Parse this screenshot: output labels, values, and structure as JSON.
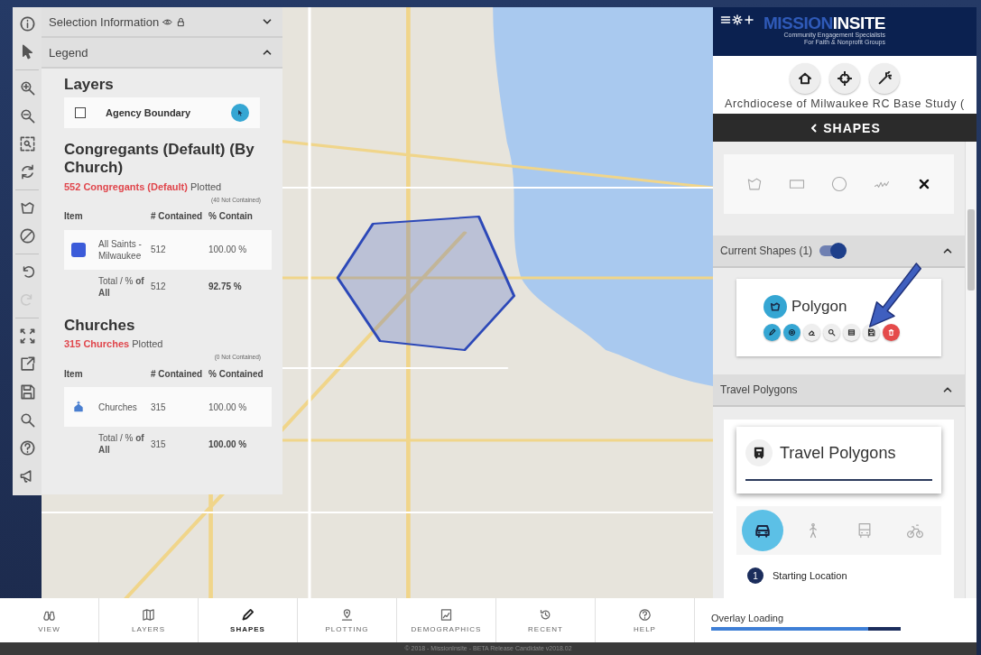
{
  "toolbar": [
    {
      "kind": "info",
      "disabled": false
    },
    {
      "kind": "pointer",
      "disabled": false
    },
    {
      "kind": "zoomin",
      "disabled": false
    },
    {
      "kind": "zoomout",
      "disabled": false
    },
    {
      "kind": "zoombox",
      "disabled": false
    },
    {
      "kind": "refresh",
      "disabled": false
    },
    {
      "kind": "polygon",
      "disabled": false
    },
    {
      "kind": "block",
      "disabled": false
    },
    {
      "kind": "undo",
      "disabled": false
    },
    {
      "kind": "redo",
      "disabled": true
    },
    {
      "kind": "expand",
      "disabled": false
    },
    {
      "kind": "export",
      "disabled": false
    },
    {
      "kind": "save",
      "disabled": false
    },
    {
      "kind": "search",
      "disabled": false
    },
    {
      "kind": "help",
      "disabled": false
    },
    {
      "kind": "megaphone",
      "disabled": false
    }
  ],
  "selection_panel": {
    "title": "Selection Information",
    "expanded": false
  },
  "legend": {
    "title": "Legend",
    "expanded": true,
    "layers": {
      "heading": "Layers",
      "items": [
        {
          "label": "Agency Boundary",
          "checked": false
        }
      ]
    },
    "sections": [
      {
        "heading": "Congregants (Default) (By Church)",
        "count": "552 Congregants (Default)",
        "plotted": "Plotted",
        "note": "(40 Not Contained)",
        "columns": [
          "Item",
          "# Contained",
          "% Contain"
        ],
        "rows": [
          {
            "kind": "swatch",
            "color": "#3b5bd9",
            "item": "All Saints - Milwaukee",
            "contained": "512",
            "percent": "100.00 %"
          }
        ],
        "total": {
          "label": "Total / % **of All**",
          "contained": "512",
          "percent": "92.75 %"
        }
      },
      {
        "heading": "Churches",
        "count": "315 Churches",
        "plotted": "Plotted",
        "note": "(0 Not Contained)",
        "columns": [
          "Item",
          "# Contained",
          "% Contained"
        ],
        "rows": [
          {
            "kind": "church",
            "color": "#4a7fd0",
            "item": "Churches",
            "contained": "315",
            "percent": "100.00 %"
          }
        ],
        "total": {
          "label": "Total / % **of All**",
          "contained": "315",
          "percent": "100.00 %"
        }
      }
    ]
  },
  "right_panel": {
    "logo": {
      "brand_a": "MISSION",
      "brand_b": "INSITE",
      "tagline_1": "Community Engagement Specialists",
      "tagline_2": "For Faith & Nonprofit Groups"
    },
    "study_title": "Archdiocese of Milwaukee RC Base Study (",
    "section_title": "SHAPES",
    "shape_tools": [
      {
        "kind": "polygon"
      },
      {
        "kind": "rect"
      },
      {
        "kind": "circle"
      },
      {
        "kind": "freehand"
      },
      {
        "kind": "close"
      }
    ],
    "current_shapes": {
      "title": "Current Shapes (1)",
      "on": true,
      "expanded": true,
      "shape": {
        "name": "Polygon",
        "actions": [
          {
            "kind": "edit",
            "active": true
          },
          {
            "kind": "buffer",
            "active": true
          },
          {
            "kind": "eraser",
            "active": false
          },
          {
            "kind": "search",
            "active": false
          },
          {
            "kind": "table",
            "active": false
          },
          {
            "kind": "save",
            "active": false
          },
          {
            "kind": "delete",
            "active": true
          }
        ]
      }
    },
    "travel": {
      "title": "Travel Polygons",
      "expanded": true,
      "card_title": "Travel Polygons",
      "modes": [
        {
          "kind": "car",
          "selected": true
        },
        {
          "kind": "walk",
          "selected": false
        },
        {
          "kind": "bus",
          "selected": false
        },
        {
          "kind": "bike",
          "selected": false
        }
      ],
      "step_number": "1",
      "step_label": "Starting Location"
    }
  },
  "nav": [
    {
      "kind": "binoculars",
      "label": "VIEW",
      "selected": false
    },
    {
      "kind": "layers",
      "label": "LAYERS",
      "selected": false
    },
    {
      "kind": "pencil",
      "label": "SHAPES",
      "selected": true
    },
    {
      "kind": "pin",
      "label": "PLOTTING",
      "selected": false
    },
    {
      "kind": "chart",
      "label": "DEMOGRAPHICS",
      "selected": false
    },
    {
      "kind": "history",
      "label": "RECENT",
      "selected": false
    },
    {
      "kind": "help",
      "label": "HELP",
      "selected": false
    }
  ],
  "overlay": {
    "label": "Overlay Loading",
    "level": 0.83
  },
  "footer": "© 2018 - MissionInsite - BETA Release Candidate v2018.02"
}
